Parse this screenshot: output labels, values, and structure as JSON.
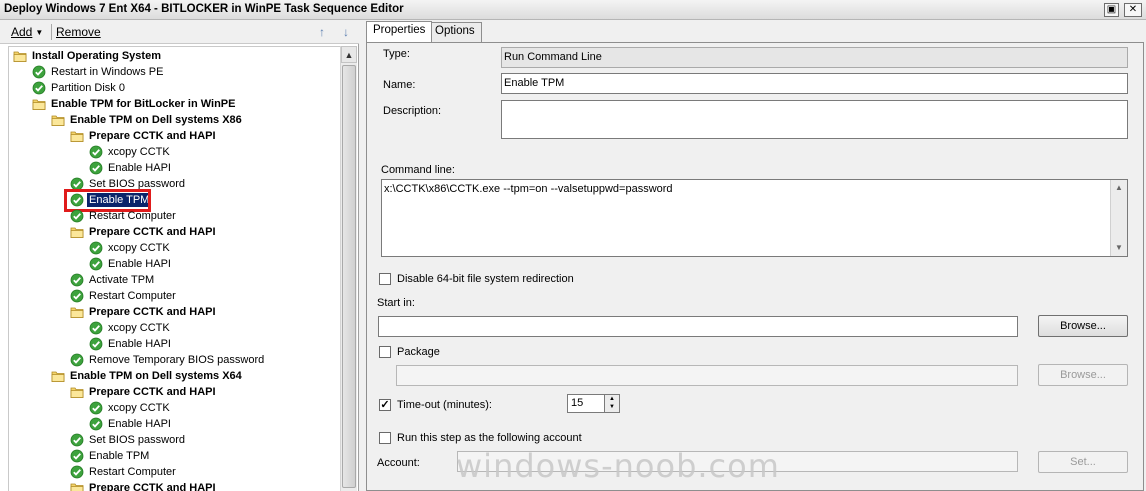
{
  "window": {
    "title": "Deploy Windows 7 Ent X64 - BITLOCKER in WinPE Task Sequence Editor",
    "restore_glyph": "▣",
    "close_glyph": "✕"
  },
  "toolbar": {
    "add_label": "Add",
    "add_arrow": "▼",
    "remove_label": "Remove",
    "move_up_icon": "↑",
    "move_down_icon": "↓"
  },
  "tree": [
    {
      "label": "Install Operating System",
      "type": "group"
    },
    {
      "label": "Restart in Windows PE",
      "type": "step"
    },
    {
      "label": "Partition Disk 0",
      "type": "step"
    },
    {
      "label": "Enable TPM for BitLocker in WinPE",
      "type": "group"
    },
    {
      "label": "Enable TPM on Dell systems X86",
      "type": "group"
    },
    {
      "label": "Prepare CCTK and HAPI",
      "type": "group"
    },
    {
      "label": "xcopy CCTK",
      "type": "step"
    },
    {
      "label": "Enable HAPI",
      "type": "step"
    },
    {
      "label": "Set BIOS password",
      "type": "step"
    },
    {
      "label": "Enable TPM",
      "type": "step",
      "selected": true
    },
    {
      "label": "Restart Computer",
      "type": "step"
    },
    {
      "label": "Prepare CCTK and HAPI",
      "type": "group"
    },
    {
      "label": "xcopy CCTK",
      "type": "step"
    },
    {
      "label": "Enable HAPI",
      "type": "step"
    },
    {
      "label": "Activate TPM",
      "type": "step"
    },
    {
      "label": "Restart Computer",
      "type": "step"
    },
    {
      "label": "Prepare CCTK and HAPI",
      "type": "group"
    },
    {
      "label": "xcopy CCTK",
      "type": "step"
    },
    {
      "label": "Enable HAPI",
      "type": "step"
    },
    {
      "label": "Remove Temporary BIOS password",
      "type": "step"
    },
    {
      "label": "Enable TPM on Dell systems X64",
      "type": "group"
    },
    {
      "label": "Prepare CCTK and HAPI",
      "type": "group"
    },
    {
      "label": "xcopy CCTK",
      "type": "step"
    },
    {
      "label": "Enable HAPI",
      "type": "step"
    },
    {
      "label": "Set BIOS password",
      "type": "step"
    },
    {
      "label": "Enable TPM",
      "type": "step"
    },
    {
      "label": "Restart Computer",
      "type": "step"
    },
    {
      "label": "Prepare CCTK and HAPI",
      "type": "group"
    }
  ],
  "tabs": {
    "properties": "Properties",
    "options": "Options"
  },
  "properties": {
    "type_label": "Type:",
    "type_value": "Run Command Line",
    "name_label": "Name:",
    "name_value": "Enable TPM",
    "description_label": "Description:",
    "description_value": "",
    "command_line_label": "Command line:",
    "command_line_value": "x:\\CCTK\\x86\\CCTK.exe --tpm=on --valsetuppwd=password",
    "disable_64bit_label": "Disable 64-bit file system redirection",
    "disable_64bit_checked": false,
    "start_in_label": "Start in:",
    "start_in_value": "",
    "browse_label": "Browse...",
    "package_label": "Package",
    "package_checked": false,
    "package_value": "",
    "browse2_label": "Browse...",
    "timeout_label": "Time-out (minutes):",
    "timeout_checked": true,
    "timeout_value": "15",
    "run_as_label": "Run this step as the following account",
    "run_as_checked": false,
    "account_label": "Account:",
    "account_value": "",
    "set_label": "Set...",
    "check_glyph": "✓",
    "spin_up": "▲",
    "spin_down": "▼",
    "scroll_up": "▲",
    "scroll_down": "▼"
  },
  "watermark": "windows-noob.com"
}
